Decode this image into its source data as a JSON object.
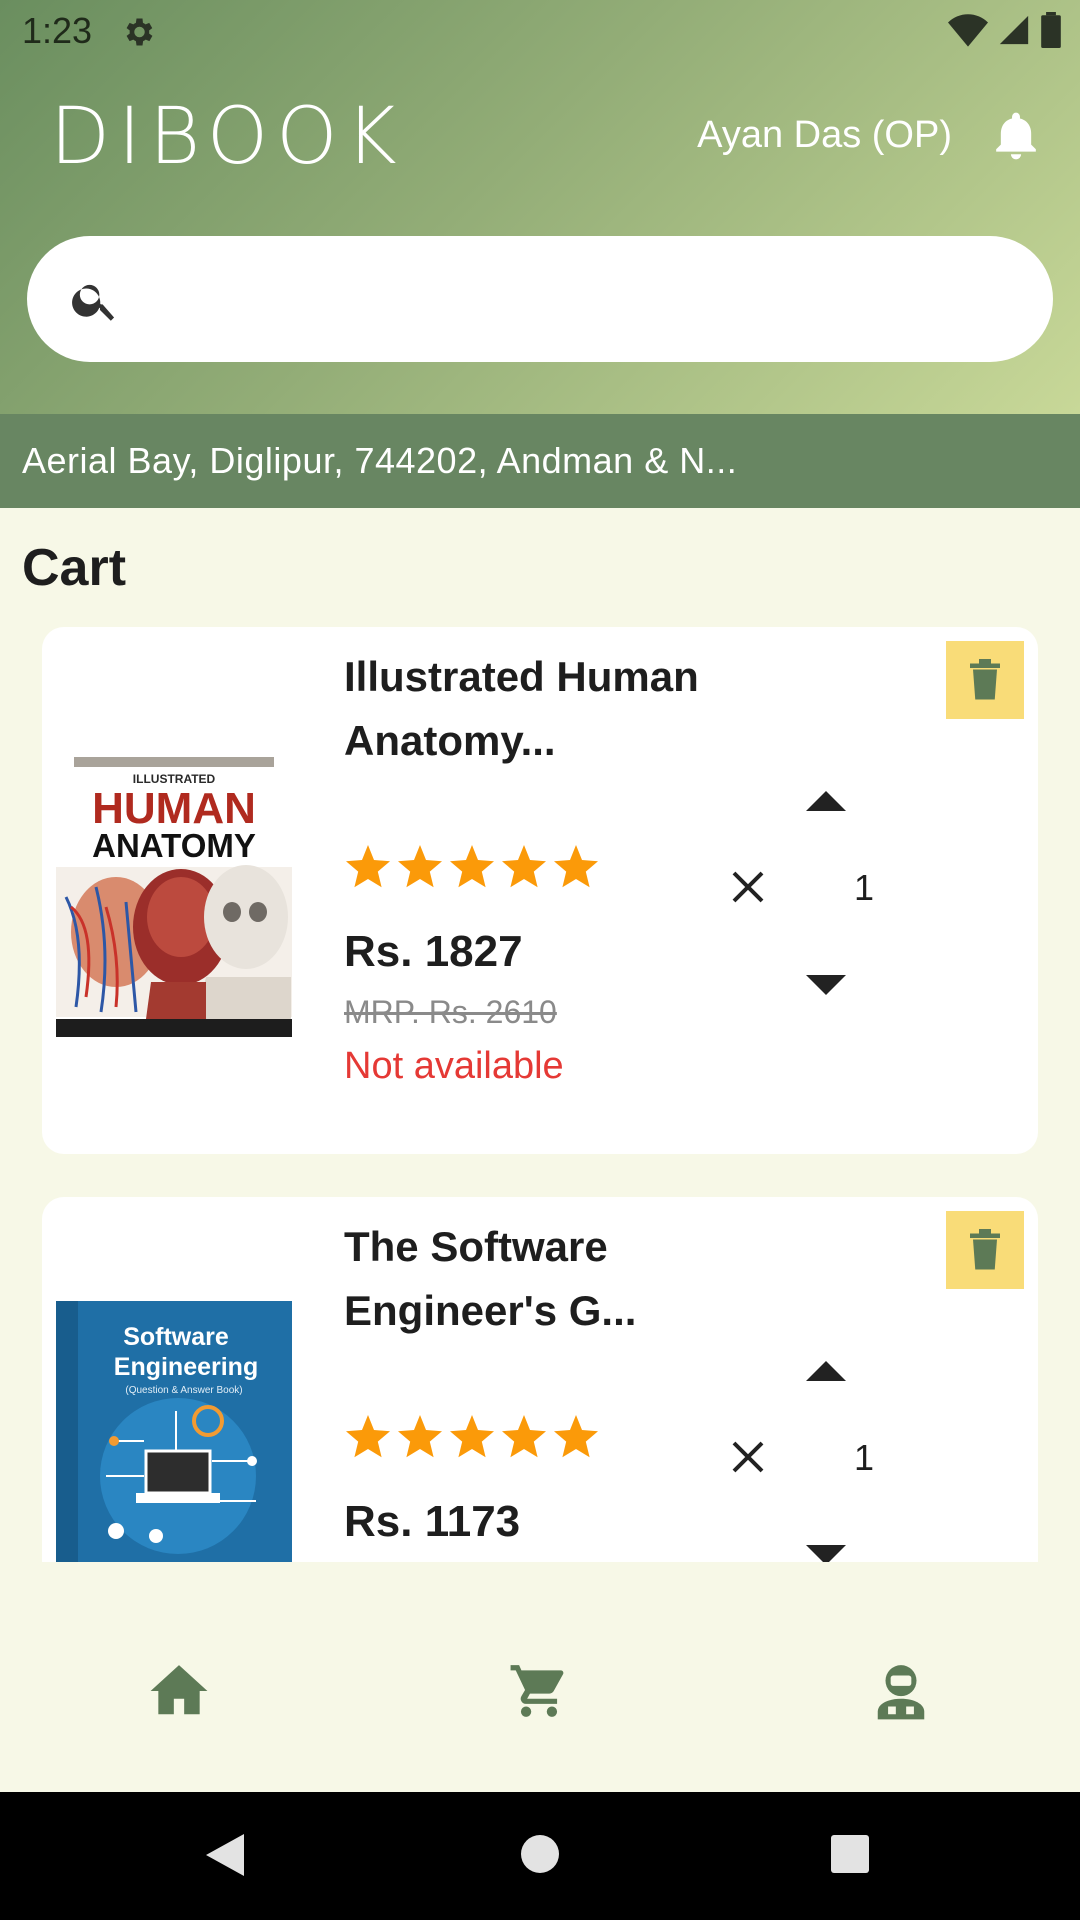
{
  "status_bar": {
    "time": "1:23"
  },
  "header": {
    "brand": "DIBOOK",
    "user_name": "Ayan Das (OP)"
  },
  "search": {
    "placeholder": ""
  },
  "location": {
    "text": "Aerial Bay, Diglipur, 744202, Andman & N..."
  },
  "cart": {
    "title": "Cart",
    "items": [
      {
        "title": "Illustrated Human Anatomy...",
        "cover_lines": [
          "ILLUSTRATED",
          "HUMAN",
          "ANATOMY"
        ],
        "rating": 5,
        "price": "Rs. 1827",
        "mrp": "MRP. Rs. 2610",
        "status": "Not available",
        "quantity": "1"
      },
      {
        "title": "The Software Engineer's G...",
        "cover_lines": [
          "Software",
          "Engineering",
          "(Question & Answer Book)"
        ],
        "rating": 5,
        "price": "Rs. 1173",
        "quantity": "1"
      }
    ]
  },
  "nav": {
    "items": [
      {
        "icon": "home-icon"
      },
      {
        "icon": "cart-icon"
      },
      {
        "icon": "profile-icon"
      }
    ]
  },
  "colors": {
    "accent_green": "#6a8e5f",
    "location_strip": "#688662",
    "delete_button": "#f9dc78",
    "star": "#fb9a09",
    "unavailable": "#e53935"
  }
}
